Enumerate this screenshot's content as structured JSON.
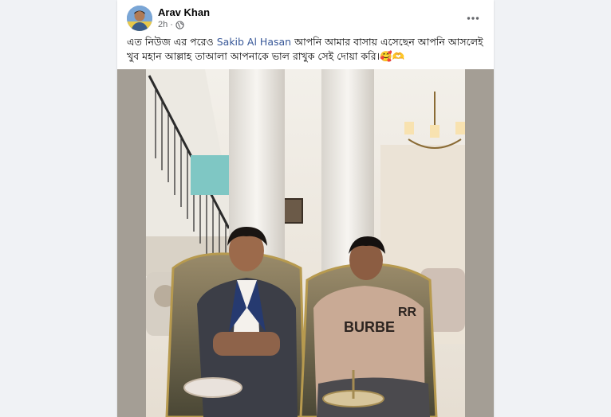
{
  "post": {
    "author": "Arav Khan",
    "time": "2h",
    "dot": "·",
    "text_before": "এত নিউজ এর পরেও ",
    "mention": "Sakib Al Hasan",
    "text_after": " আপনি আমার বাসায় এসেছেন আপনি আসলেই খুব মহান আল্লাহ তাআলা আপনাকে ভাল রাখুক সেই দোয়া করি।",
    "emojis": "🥰🫶",
    "privacy_icon": "globe-icon",
    "more_icon": "more-options-icon"
  },
  "colors": {
    "page_background": "#f0f2f5",
    "link": "#385898",
    "secondary_text": "#65676b"
  }
}
